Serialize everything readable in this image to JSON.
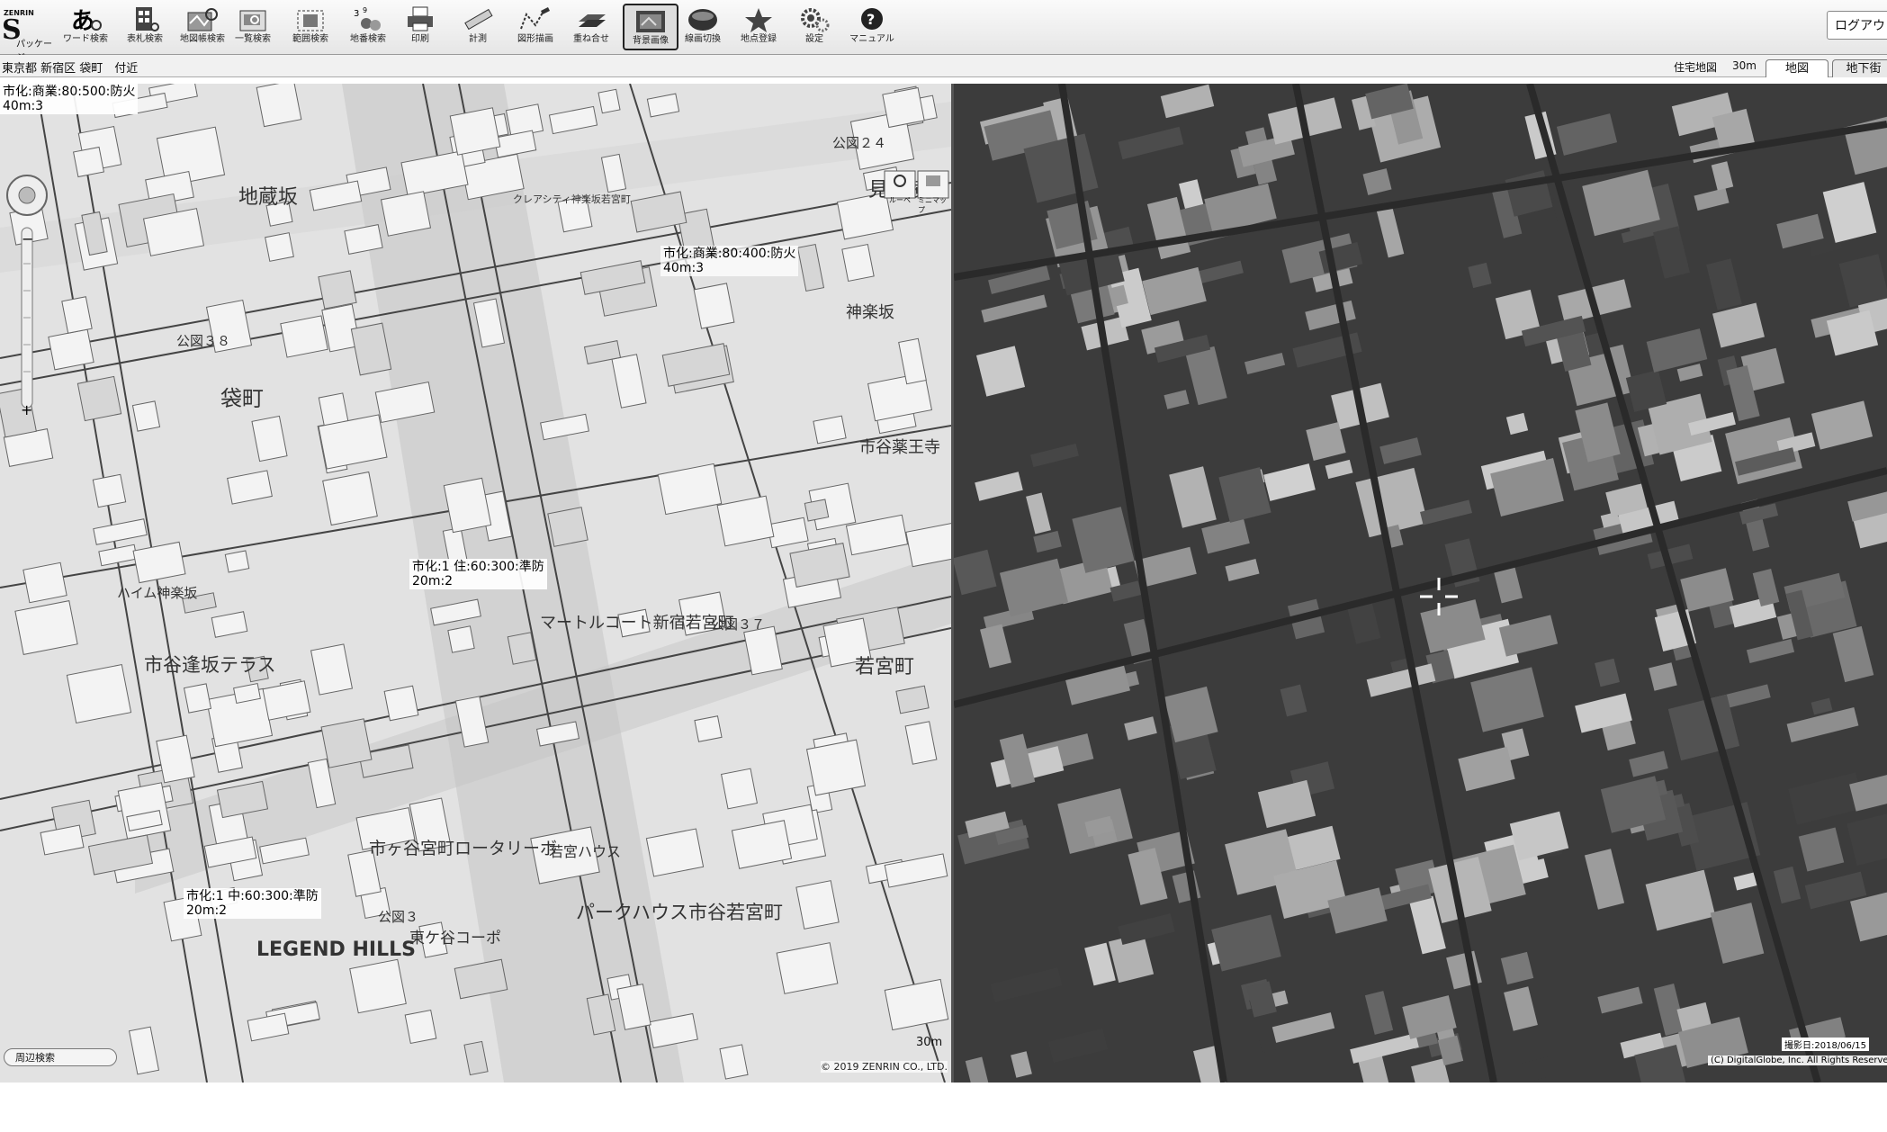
{
  "logo": {
    "top_text": "ZENRIN",
    "main": "S",
    "sub": "パッケージ"
  },
  "toolbar": {
    "items": [
      {
        "label": "ワード検索",
        "icon": "word-search-icon"
      },
      {
        "label": "表札検索",
        "icon": "nameplate-search-icon"
      },
      {
        "label": "地図帳検索",
        "icon": "atlas-search-icon"
      },
      {
        "label": "一覧検索",
        "icon": "list-search-icon"
      },
      {
        "label": "範囲検索",
        "icon": "area-search-icon"
      },
      {
        "label": "地番検索",
        "icon": "lot-search-icon"
      },
      {
        "label": "印刷",
        "icon": "print-icon"
      },
      {
        "label": "計測",
        "icon": "measure-icon"
      },
      {
        "label": "図形描画",
        "icon": "draw-icon"
      },
      {
        "label": "重ね合せ",
        "icon": "overlay-icon"
      },
      {
        "label": "背景画像",
        "icon": "background-image-icon"
      },
      {
        "label": "線画切換",
        "icon": "line-switch-icon"
      },
      {
        "label": "地点登録",
        "icon": "star-icon"
      },
      {
        "label": "設定",
        "icon": "gear-icon"
      },
      {
        "label": "マニュアル",
        "icon": "help-icon"
      }
    ],
    "logout": "ログアウ"
  },
  "addressbar": {
    "address": "東京都 新宿区 袋町　付近",
    "map_type": "住宅地図",
    "scale": "30m",
    "tabs": [
      "地図",
      "地下街"
    ]
  },
  "map": {
    "annotations": [
      [
        "市化:商業:80:500:防火",
        "40m:3"
      ],
      [
        "市化:商業:80:400:防火",
        "40m:3"
      ],
      [
        "市化:1 住:60:300:準防",
        "20m:2"
      ],
      [
        "市化:1 中:60:300:準防",
        "20m:2"
      ]
    ],
    "labels": [
      "地蔵坂",
      "袋町",
      "見番横丁",
      "神楽坂",
      "市谷薬王寺",
      "若宮町",
      "公図３８",
      "公図２４",
      "公図３７",
      "公図３",
      "市谷逢坂テラス",
      "マートルコート新宿若宮町",
      "パークハウス市谷若宮町",
      "市ヶ谷宮町ロータリーボ",
      "LEGEND HILLS",
      "ハイム神楽坂",
      "若宮ハウス",
      "東ケ谷コーポ",
      "クレアシティ神楽坂若宮町"
    ],
    "zoom_toolbox": [
      "ルーペ",
      "ミニマップ"
    ],
    "scale_text": "30m",
    "search_box": "周辺検索",
    "copyright": "© 2019 ZENRIN CO., LTD."
  },
  "photo": {
    "date": "撮影日:2018/06/15",
    "credit": "(C) DigitalGlobe, Inc. All Rights Reserved"
  }
}
